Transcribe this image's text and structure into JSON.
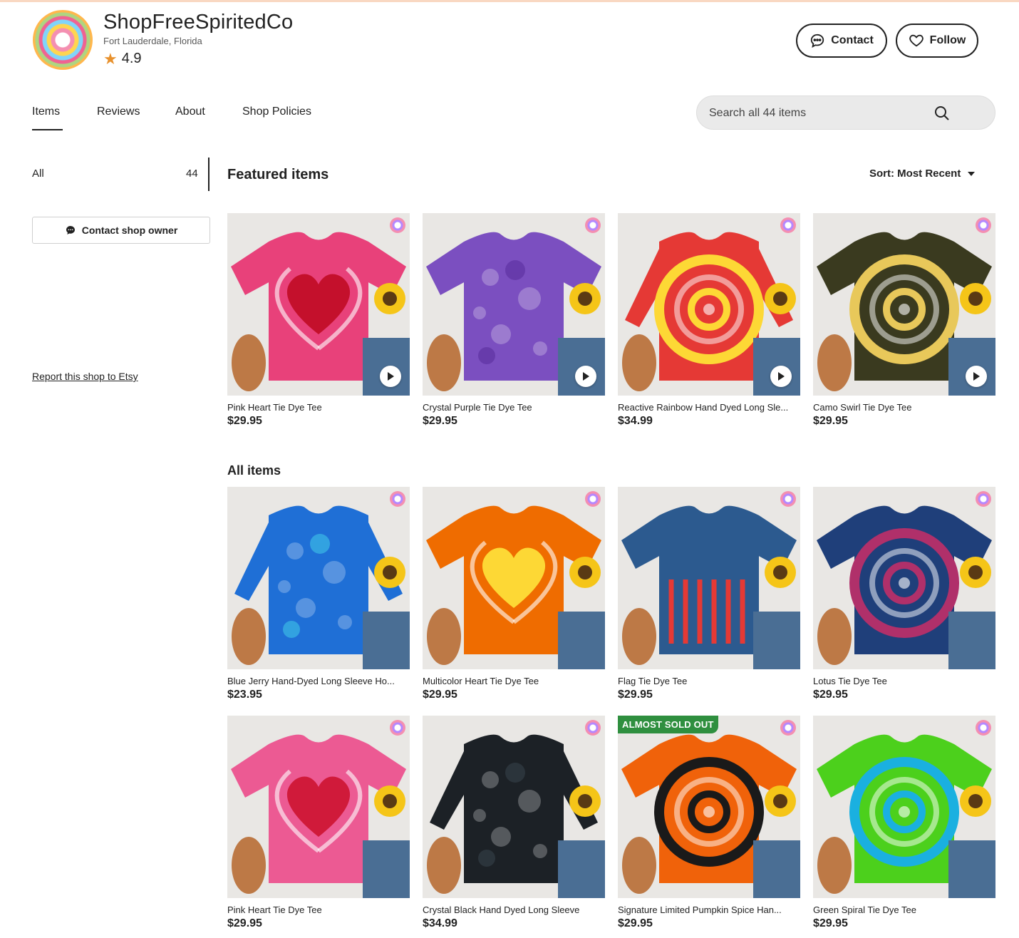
{
  "shop": {
    "name": "ShopFreeSpiritedCo",
    "location": "Fort Lauderdale, Florida",
    "rating": "4.9",
    "contact_label": "Contact",
    "follow_label": "Follow"
  },
  "tabs": [
    {
      "label": "Items",
      "active": true
    },
    {
      "label": "Reviews"
    },
    {
      "label": "About"
    },
    {
      "label": "Shop Policies"
    }
  ],
  "search": {
    "placeholder": "Search all 44 items"
  },
  "sidebar": {
    "all_label": "All",
    "all_count": "44",
    "contact_owner_label": "Contact shop owner",
    "report_label": "Report this shop to Etsy"
  },
  "featured": {
    "title": "Featured items",
    "sort_label": "Sort: Most Recent",
    "items": [
      {
        "title": "Pink Heart Tie Dye Tee",
        "price": "$29.95",
        "video": true,
        "shirt": "#e8417a",
        "accent": "#c4102c",
        "pattern": "heart"
      },
      {
        "title": "Crystal Purple Tie Dye Tee",
        "price": "$29.95",
        "video": true,
        "shirt": "#7b4fc0",
        "accent": "#5a2e9e",
        "pattern": "crystal"
      },
      {
        "title": "Reactive Rainbow Hand Dyed Long Sle...",
        "price": "$34.99",
        "video": true,
        "shirt": "#e53935",
        "accent": "#fdd835",
        "pattern": "swirl"
      },
      {
        "title": "Camo Swirl Tie Dye Tee",
        "price": "$29.95",
        "video": true,
        "shirt": "#3a3a1f",
        "accent": "#e8c85a",
        "pattern": "swirl"
      }
    ]
  },
  "all_items": {
    "title": "All items",
    "items": [
      {
        "title": "Blue Jerry Hand-Dyed Long Sleeve Ho...",
        "price": "$23.95",
        "shirt": "#1f6fd6",
        "accent": "#3fc4e8",
        "pattern": "crystal"
      },
      {
        "title": "Multicolor Heart Tie Dye Tee",
        "price": "$29.95",
        "shirt": "#ef6c00",
        "accent": "#fdd835",
        "pattern": "heart"
      },
      {
        "title": "Flag Tie Dye Tee",
        "price": "$29.95",
        "shirt": "#2c5a8f",
        "accent": "#e53935",
        "pattern": "flag"
      },
      {
        "title": "Lotus Tie Dye Tee",
        "price": "$29.95",
        "shirt": "#1f3f7a",
        "accent": "#b0306a",
        "pattern": "swirl"
      },
      {
        "title": "Pink Heart Tie Dye Tee",
        "price": "$29.95",
        "shirt": "#ec5a93",
        "accent": "#d01a3a",
        "pattern": "heart"
      },
      {
        "title": "Crystal Black Hand Dyed Long Sleeve",
        "price": "$34.99",
        "shirt": "#1c2126",
        "accent": "#36414a",
        "pattern": "crystal"
      },
      {
        "title": "Signature Limited Pumpkin Spice Han...",
        "price": "$29.95",
        "badge": "ALMOST SOLD OUT",
        "shirt": "#f0620a",
        "accent": "#1a1a1a",
        "pattern": "swirl"
      },
      {
        "title": "Green Spiral Tie Dye Tee",
        "price": "$29.95",
        "shirt": "#4cd01c",
        "accent": "#1ab0e0",
        "pattern": "swirl"
      }
    ]
  }
}
